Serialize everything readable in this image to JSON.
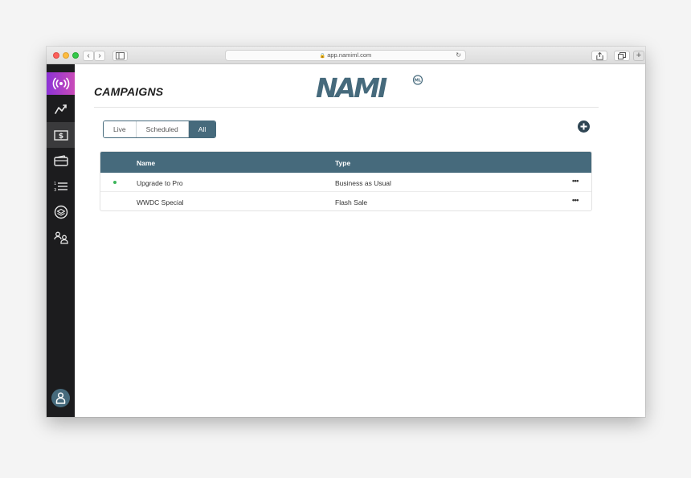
{
  "browser": {
    "url": "app.namiml.com"
  },
  "page": {
    "title": "CAMPAIGNS",
    "logo_text": "NAMI",
    "logo_badge": "ML"
  },
  "filters": {
    "tabs": [
      {
        "label": "Live"
      },
      {
        "label": "Scheduled"
      },
      {
        "label": "All",
        "selected": true
      }
    ]
  },
  "table": {
    "columns": [
      "Name",
      "Type"
    ],
    "rows": [
      {
        "name": "Upgrade to Pro",
        "type": "Business as Usual",
        "active": true
      },
      {
        "name": "WWDC Special",
        "type": "Flash Sale",
        "active": false
      }
    ],
    "row_action_icon": "ellipsis-icon"
  },
  "sidebar": {
    "items": [
      {
        "icon": "live-broadcast-icon"
      },
      {
        "icon": "analytics-icon"
      },
      {
        "icon": "dollar-bill-icon",
        "active": true
      },
      {
        "icon": "wallet-icon"
      },
      {
        "icon": "list-icon"
      },
      {
        "icon": "layers-icon"
      },
      {
        "icon": "users-icon"
      }
    ],
    "account_icon": "user-avatar-icon"
  },
  "colors": {
    "accent": "#466a7c",
    "sidebar_bg": "#1c1c1e",
    "live_gradient_start": "#8c32d6",
    "live_gradient_end": "#c94bb8",
    "status_active": "#3cb55a"
  }
}
